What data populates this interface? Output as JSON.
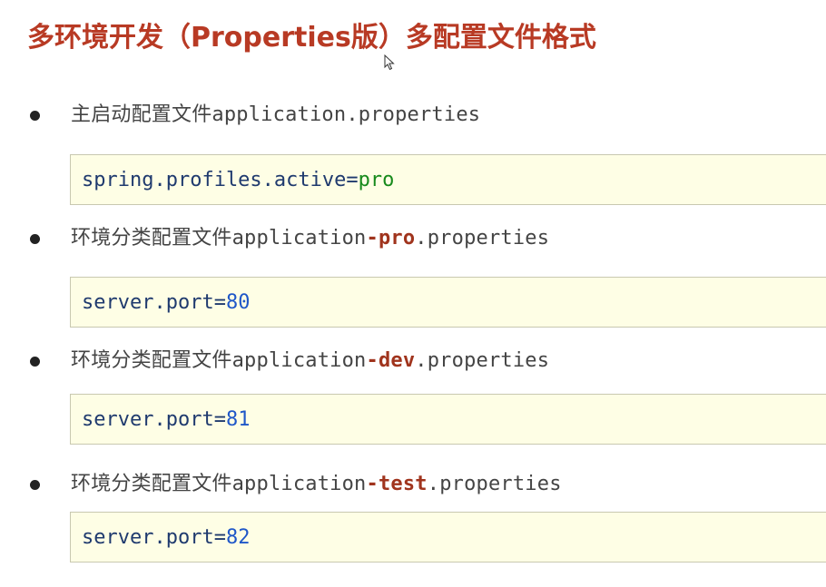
{
  "title": "多环境开发（Properties版）多配置文件格式",
  "items": [
    {
      "label_prefix": "主启动配置文件",
      "file_base": "application",
      "file_highlight": "",
      "file_suffix": ".properties",
      "code_key": "spring.profiles.active",
      "code_eq": "=",
      "code_value": "pro"
    },
    {
      "label_prefix": "环境分类配置文件",
      "file_base": "application",
      "file_highlight": "-pro",
      "file_suffix": ".properties",
      "code_key": "server.port",
      "code_eq": "=",
      "code_value": "80"
    },
    {
      "label_prefix": "环境分类配置文件",
      "file_base": "application",
      "file_highlight": "-dev",
      "file_suffix": ".properties",
      "code_key": "server.port",
      "code_eq": "=",
      "code_value": "81"
    },
    {
      "label_prefix": "环境分类配置文件",
      "file_base": "application",
      "file_highlight": "-test",
      "file_suffix": ".properties",
      "code_key": "server.port",
      "code_eq": "=",
      "code_value": "82"
    }
  ],
  "colors": {
    "title": "#b83a24",
    "highlight": "#a0341d",
    "code_background": "#fefee5",
    "code_key": "#1f3a6e",
    "code_string": "#178a1b",
    "code_number": "#1f57c8"
  }
}
